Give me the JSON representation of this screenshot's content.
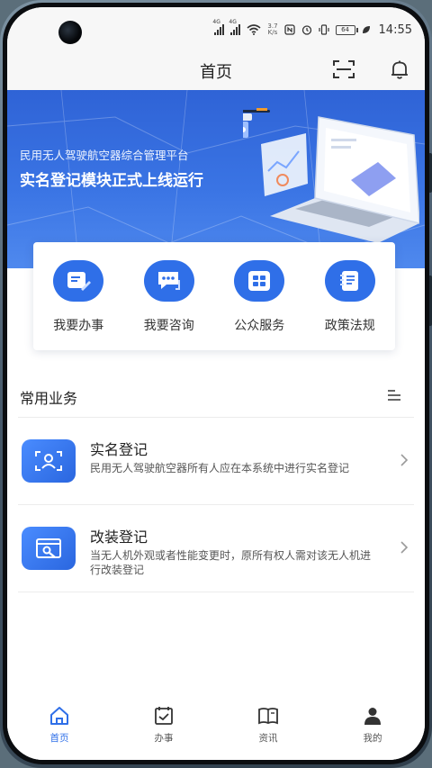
{
  "status_bar": {
    "signal1_tag": "4G",
    "signal2_tag": "4G",
    "speed_value": "3.7",
    "speed_unit": "K/s",
    "battery": "64",
    "time": "14:55"
  },
  "header": {
    "title": "首页",
    "scan_icon": "scan-icon",
    "bell_icon": "bell-icon"
  },
  "banner": {
    "subtitle": "民用无人驾驶航空器综合管理平台",
    "title": "实名登记模块正式上线运行"
  },
  "quick_actions": [
    {
      "label": "我要办事",
      "icon": "form-edit-icon"
    },
    {
      "label": "我要咨询",
      "icon": "chat-icon"
    },
    {
      "label": "公众服务",
      "icon": "grid-icon"
    },
    {
      "label": "政策法规",
      "icon": "notebook-icon"
    }
  ],
  "common_business": {
    "title": "常用业务",
    "items": [
      {
        "name": "实名登记",
        "desc": "民用无人驾驶航空器所有人应在本系统中进行实名登记",
        "icon": "person-scan-icon"
      },
      {
        "name": "改装登记",
        "desc": "当无人机外观或者性能变更时，原所有权人需对该无人机进行改装登记",
        "icon": "window-tool-icon"
      }
    ]
  },
  "bottom_nav": [
    {
      "label": "首页",
      "icon": "home-icon",
      "active": true
    },
    {
      "label": "办事",
      "icon": "checkbox-icon",
      "active": false
    },
    {
      "label": "资讯",
      "icon": "book-icon",
      "active": false
    },
    {
      "label": "我的",
      "icon": "user-icon",
      "active": false
    }
  ],
  "colors": {
    "accent": "#2f6fe8",
    "banner_top": "#2f63d6",
    "banner_bottom": "#4f89ee",
    "text": "#222222"
  }
}
